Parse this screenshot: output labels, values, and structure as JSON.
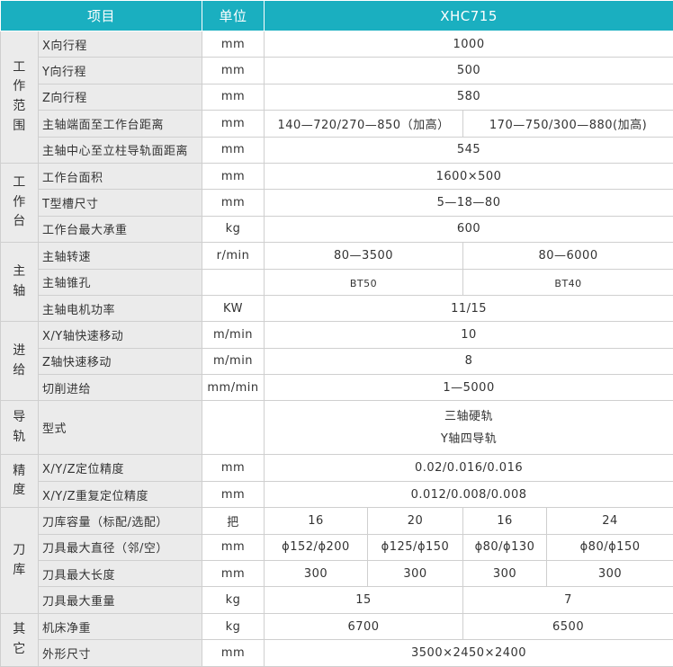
{
  "header": {
    "item": "项目",
    "unit": "单位",
    "model": "XHC715"
  },
  "groups": {
    "work_range": [
      "工",
      "作",
      "范",
      "围"
    ],
    "worktable": [
      "工",
      "作",
      "台"
    ],
    "spindle": [
      "主",
      "轴"
    ],
    "feed": [
      "进",
      "给"
    ],
    "guide": [
      "导",
      "轨"
    ],
    "precision": [
      "精",
      "度"
    ],
    "magazine": [
      "刀",
      "库"
    ],
    "other": [
      "其",
      "它"
    ]
  },
  "rows": {
    "x_travel": {
      "label": "X向行程",
      "unit": "mm",
      "value": "1000"
    },
    "y_travel": {
      "label": "Y向行程",
      "unit": "mm",
      "value": "500"
    },
    "z_travel": {
      "label": "Z向行程",
      "unit": "mm",
      "value": "580"
    },
    "spindle_nose": {
      "label": "主轴端面至工作台距离",
      "unit": "mm",
      "value_a": "140—720/270—850（加高）",
      "value_b": "170—750/300—880(加高)"
    },
    "spindle_center": {
      "label": "主轴中心至立柱导轨面距离",
      "unit": "mm",
      "value": "545"
    },
    "table_area": {
      "label": "工作台面积",
      "unit": "mm",
      "value": "1600×500"
    },
    "t_slot": {
      "label": "T型槽尺寸",
      "unit": "mm",
      "value": "5—18—80"
    },
    "table_load": {
      "label": "工作台最大承重",
      "unit": "kg",
      "value": "600"
    },
    "spindle_speed": {
      "label": "主轴转速",
      "unit": "r/min",
      "value_a": "80—3500",
      "value_b": "80—6000"
    },
    "spindle_taper": {
      "label": "主轴锥孔",
      "unit": "",
      "value_a": "BT50",
      "value_b": "BT40"
    },
    "spindle_power": {
      "label": "主轴电机功率",
      "unit": "KW",
      "value": "11/15"
    },
    "xy_rapid": {
      "label": "X/Y轴快速移动",
      "unit": "m/min",
      "value": "10"
    },
    "z_rapid": {
      "label": "Z轴快速移动",
      "unit": "m/min",
      "value": "8"
    },
    "cut_feed": {
      "label": "切削进给",
      "unit": "mm/min",
      "value": "1—5000"
    },
    "guide_type": {
      "label": "型式",
      "unit": "",
      "value_line1": "三轴硬轨",
      "value_line2": "Y轴四导轨"
    },
    "positioning": {
      "label": "X/Y/Z定位精度",
      "unit": "mm",
      "value": "0.02/0.016/0.016"
    },
    "repeatability": {
      "label": "X/Y/Z重复定位精度",
      "unit": "mm",
      "value": "0.012/0.008/0.008"
    },
    "tool_capacity": {
      "label": "刀库容量（标配/选配）",
      "unit": "把",
      "values": [
        "16",
        "20",
        "16",
        "24"
      ]
    },
    "tool_diameter": {
      "label": "刀具最大直径（邻/空）",
      "unit": "mm",
      "values": [
        "ϕ152/ϕ200",
        "ϕ125/ϕ150",
        "ϕ80/ϕ130",
        "ϕ80/ϕ150"
      ]
    },
    "tool_length": {
      "label": "刀具最大长度",
      "unit": "mm",
      "values": [
        "300",
        "300",
        "300",
        "300"
      ]
    },
    "tool_weight": {
      "label": "刀具最大重量",
      "unit": "kg",
      "value_a": "15",
      "value_b": "7"
    },
    "net_weight": {
      "label": "机床净重",
      "unit": "kg",
      "value_a": "6700",
      "value_b": "6500"
    },
    "dimensions": {
      "label": "外形尺寸",
      "unit": "mm",
      "value": "3500×2450×2400"
    }
  }
}
